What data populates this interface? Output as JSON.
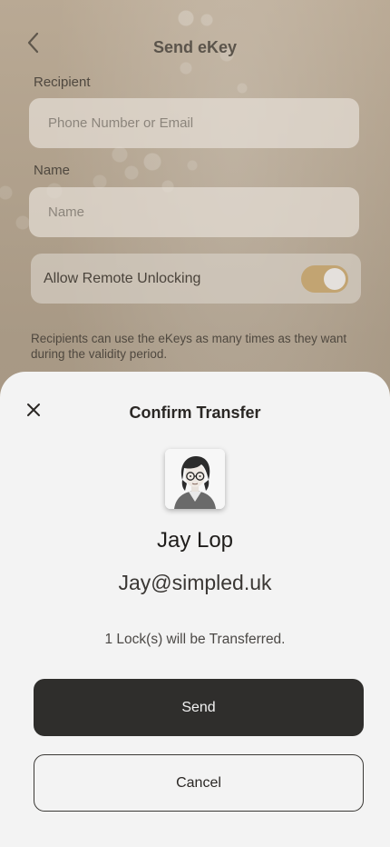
{
  "background_screen": {
    "title": "Send eKey",
    "recipient_label": "Recipient",
    "recipient_placeholder": "Phone Number or Email",
    "name_label": "Name",
    "name_placeholder": "Name",
    "remote_unlock_label": "Allow Remote Unlocking",
    "remote_unlock_on": true,
    "note": "Recipients can use the eKeys as many times as they want during the validity period."
  },
  "sheet": {
    "title": "Confirm Transfer",
    "recipient_name": "Jay Lop",
    "recipient_email": "Jay@simpled.uk",
    "transfer_note": "1 Lock(s) will be Transferred.",
    "send_label": "Send",
    "cancel_label": "Cancel"
  },
  "colors": {
    "toggle_on": "#c2a472",
    "send_button": "#2f2e2c",
    "sheet_background": "#f3f3f3"
  },
  "icons": {
    "back": "chevron-left-icon",
    "close": "close-icon"
  }
}
